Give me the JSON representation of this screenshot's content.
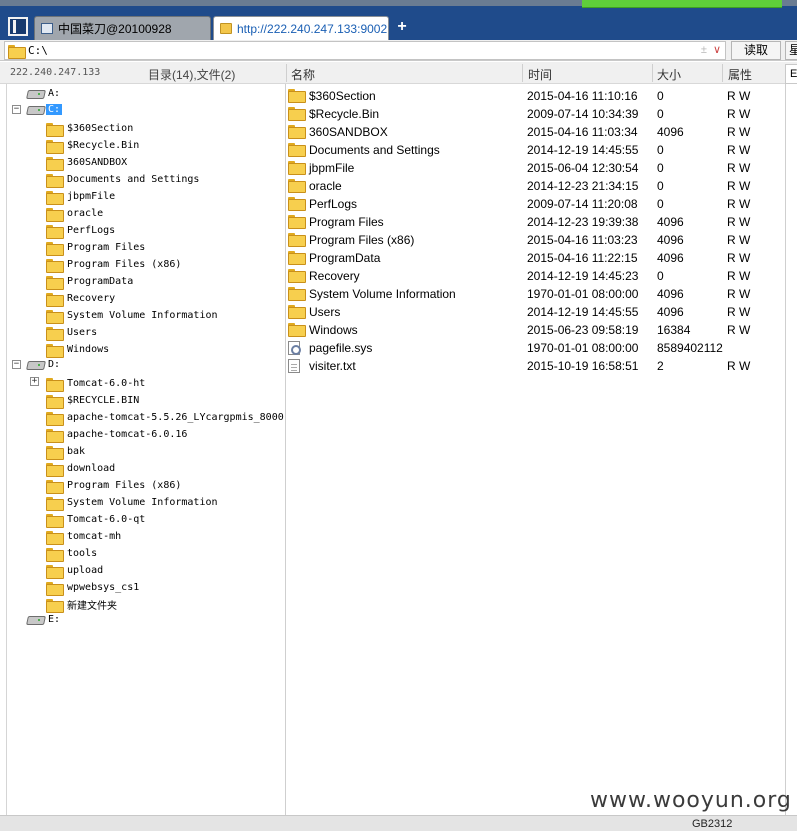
{
  "browser": {
    "tabs": [
      {
        "title": "中国菜刀@20100928"
      },
      {
        "title": "http://222.240.247.133:9002..."
      }
    ],
    "new_tab_label": "+"
  },
  "address": {
    "path": "C:\\",
    "plusminus": "±",
    "dropdown": "∨",
    "read_button": "读取",
    "cut_label": "星"
  },
  "header": {
    "ip": "222.240.247.133",
    "counts": "目录(14),文件(2)",
    "columns": {
      "name": "名称",
      "time": "时间",
      "size": "大小",
      "attr": "属性"
    },
    "right_tab": "E"
  },
  "tree": {
    "drive_a": "A:",
    "drive_c": "C:",
    "c_children": [
      "$360Section",
      "$Recycle.Bin",
      "360SANDBOX",
      "Documents and Settings",
      "jbpmFile",
      "oracle",
      "PerfLogs",
      "Program Files",
      "Program Files (x86)",
      "ProgramData",
      "Recovery",
      "System Volume Information",
      "Users",
      "Windows"
    ],
    "drive_d": "D:",
    "d_children": [
      "Tomcat-6.0-ht",
      "$RECYCLE.BIN",
      "apache-tomcat-5.5.26_LYcargpmis_8000",
      "apache-tomcat-6.0.16",
      "bak",
      "download",
      "Program Files (x86)",
      "System Volume Information",
      "Tomcat-6.0-qt",
      "tomcat-mh",
      "tools",
      "upload",
      "wpwebsys_cs1",
      "新建文件夹"
    ],
    "drive_e": "E:",
    "expander_minus": "−",
    "expander_plus": "+"
  },
  "files": [
    {
      "name": "$360Section",
      "time": "2015-04-16 11:10:16",
      "size": "0",
      "attr": "R W",
      "kind": "folder"
    },
    {
      "name": "$Recycle.Bin",
      "time": "2009-07-14 10:34:39",
      "size": "0",
      "attr": "R W",
      "kind": "folder"
    },
    {
      "name": "360SANDBOX",
      "time": "2015-04-16 11:03:34",
      "size": "4096",
      "attr": "R W",
      "kind": "folder"
    },
    {
      "name": "Documents and Settings",
      "time": "2014-12-19 14:45:55",
      "size": "0",
      "attr": "R W",
      "kind": "folder"
    },
    {
      "name": "jbpmFile",
      "time": "2015-06-04 12:30:54",
      "size": "0",
      "attr": "R W",
      "kind": "folder"
    },
    {
      "name": "oracle",
      "time": "2014-12-23 21:34:15",
      "size": "0",
      "attr": "R W",
      "kind": "folder"
    },
    {
      "name": "PerfLogs",
      "time": "2009-07-14 11:20:08",
      "size": "0",
      "attr": "R W",
      "kind": "folder"
    },
    {
      "name": "Program Files",
      "time": "2014-12-23 19:39:38",
      "size": "4096",
      "attr": "R W",
      "kind": "folder"
    },
    {
      "name": "Program Files (x86)",
      "time": "2015-04-16 11:03:23",
      "size": "4096",
      "attr": "R W",
      "kind": "folder"
    },
    {
      "name": "ProgramData",
      "time": "2015-04-16 11:22:15",
      "size": "4096",
      "attr": "R W",
      "kind": "folder"
    },
    {
      "name": "Recovery",
      "time": "2014-12-19 14:45:23",
      "size": "0",
      "attr": "R W",
      "kind": "folder"
    },
    {
      "name": "System Volume Information",
      "time": "1970-01-01 08:00:00",
      "size": "4096",
      "attr": "R W",
      "kind": "folder"
    },
    {
      "name": "Users",
      "time": "2014-12-19 14:45:55",
      "size": "4096",
      "attr": "R W",
      "kind": "folder"
    },
    {
      "name": "Windows",
      "time": "2015-06-23 09:58:19",
      "size": "16384",
      "attr": "R W",
      "kind": "folder"
    },
    {
      "name": "pagefile.sys",
      "time": "1970-01-01 08:00:00",
      "size": "8589402112",
      "attr": "",
      "kind": "sysfile"
    },
    {
      "name": "visiter.txt",
      "time": "2015-10-19 16:58:51",
      "size": "2",
      "attr": "R W",
      "kind": "file"
    }
  ],
  "status": {
    "encoding": "GB2312"
  },
  "watermark": "www.wooyun.org"
}
